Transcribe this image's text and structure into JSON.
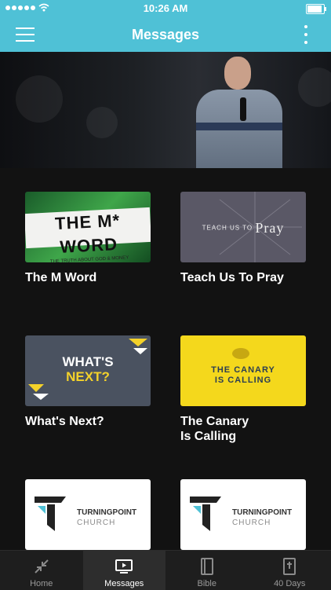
{
  "status_bar": {
    "time": "10:26 AM",
    "battery_level": 1.0
  },
  "nav": {
    "title": "Messages"
  },
  "series": [
    {
      "label": "The M Word",
      "art_title": "THE M* WORD",
      "art_subtitle": "THE TRUTH ABOUT GOD & MONEY"
    },
    {
      "label": "Teach Us To Pray",
      "art_small": "TEACH US TO",
      "art_big": "Pray"
    },
    {
      "label": "What's Next?",
      "art_line1": "WHAT'S",
      "art_line2": "NEXT?"
    },
    {
      "label": "The Canary\nIs Calling",
      "art_line1": "THE CANARY",
      "art_line2": "IS CALLING"
    },
    {
      "label": "",
      "art_name": "TURNINGPOINT",
      "art_sub": "CHURCH"
    },
    {
      "label": "",
      "art_name": "TURNINGPOINT",
      "art_sub": "CHURCH"
    }
  ],
  "tabs": [
    {
      "label": "Home",
      "icon": "collapse-arrows-icon"
    },
    {
      "label": "Messages",
      "icon": "play-screen-icon"
    },
    {
      "label": "Bible",
      "icon": "book-icon"
    },
    {
      "label": "40 Days",
      "icon": "bible-cross-icon"
    }
  ],
  "colors": {
    "accent": "#4fc1d6",
    "background": "#121212",
    "tabbar": "#1e1e1e",
    "canary": "#f4d81c"
  }
}
